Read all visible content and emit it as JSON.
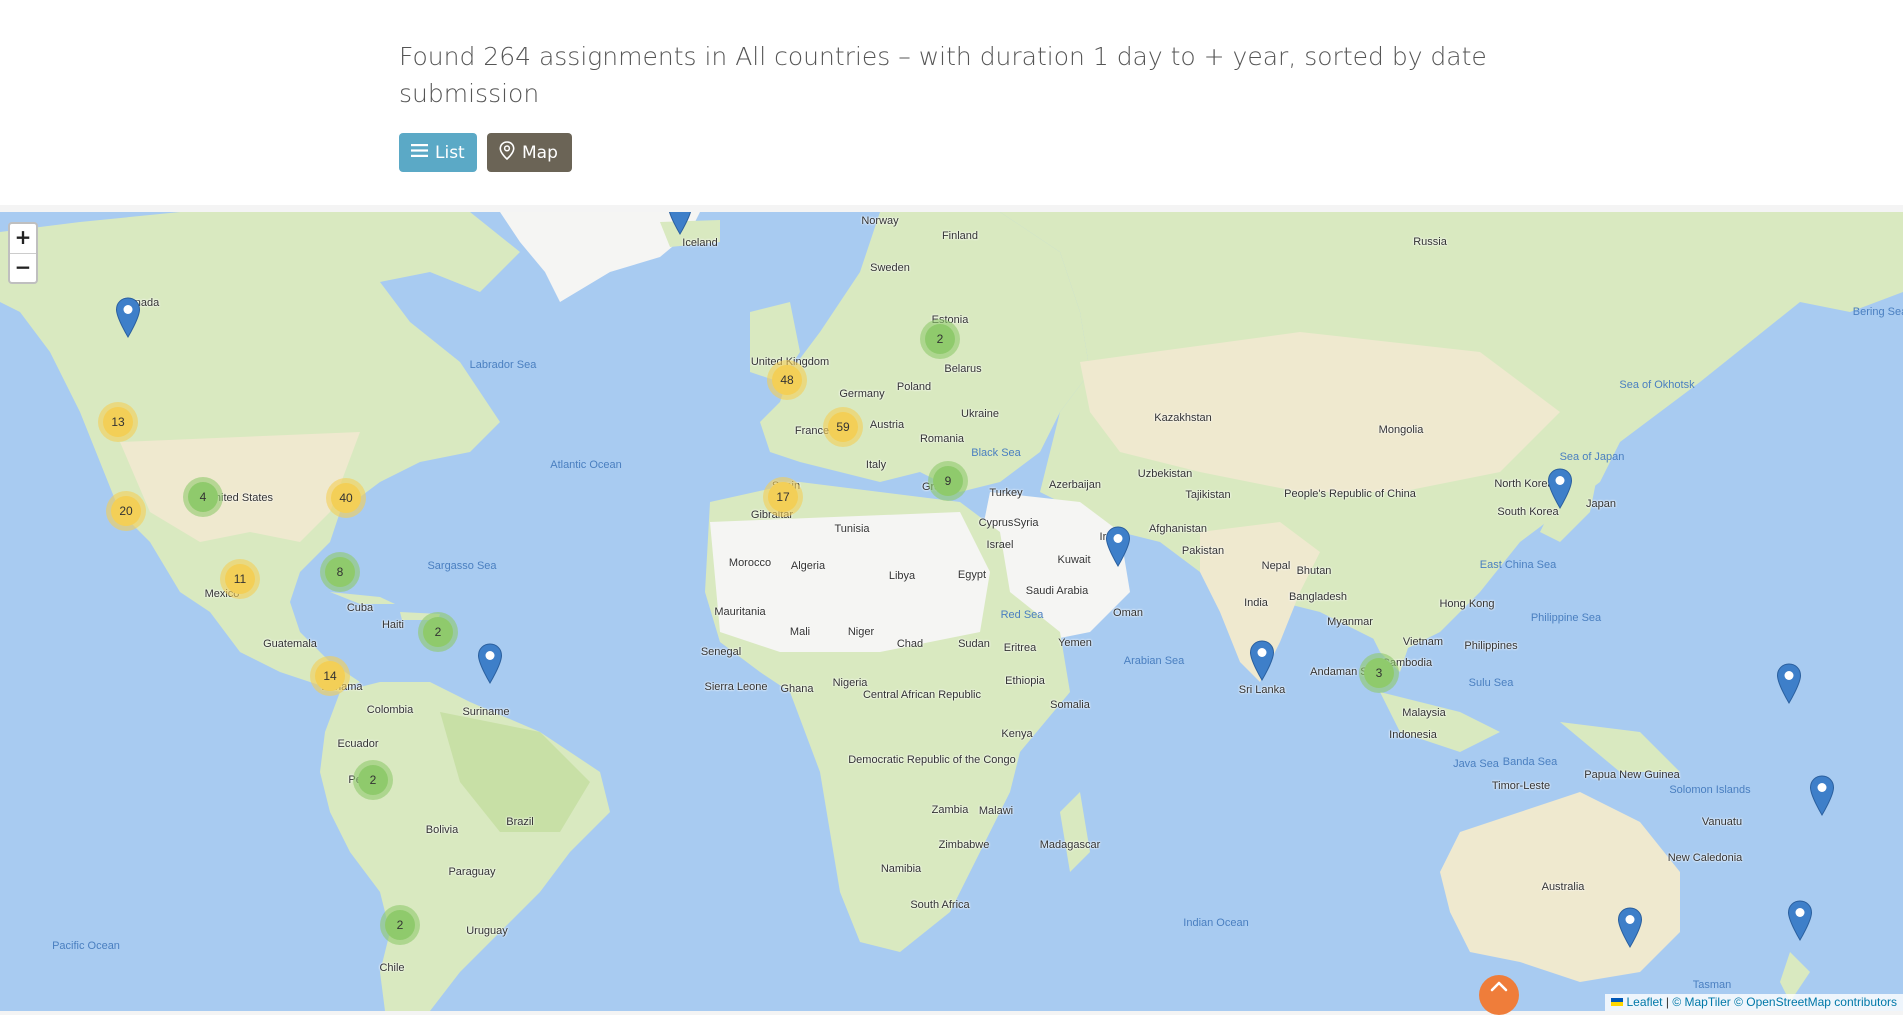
{
  "header": {
    "result_text": "Found 264 assignments in All countries – with duration 1 day to + year, sorted by date submission"
  },
  "view_toggle": {
    "list_label": "List",
    "map_label": "Map",
    "list_icon": "hamburger-icon",
    "map_icon": "map-pin-icon"
  },
  "zoom": {
    "in_label": "+",
    "out_label": "−"
  },
  "attribution": {
    "leaflet": "Leaflet",
    "separator": "|",
    "maptiler": "© MapTiler",
    "osm": "© OpenStreetMap contributors"
  },
  "colors": {
    "list_button": "#5ba9c6",
    "map_button": "#6b6456",
    "water": "#a8cbf1",
    "cluster_small": "#8fca6c",
    "cluster_large": "#f3cf57",
    "marker": "#3e7fc9",
    "scroll_top": "#ef7d3a"
  },
  "map": {
    "clusters": [
      {
        "count": "2",
        "size": "small"
      },
      {
        "count": "48",
        "size": "large"
      },
      {
        "count": "59",
        "size": "large"
      },
      {
        "count": "13",
        "size": "large"
      },
      {
        "count": "20",
        "size": "large"
      },
      {
        "count": "4",
        "size": "small"
      },
      {
        "count": "40",
        "size": "large"
      },
      {
        "count": "17",
        "size": "large"
      },
      {
        "count": "9",
        "size": "small"
      },
      {
        "count": "11",
        "size": "large"
      },
      {
        "count": "8",
        "size": "small"
      },
      {
        "count": "2",
        "size": "small"
      },
      {
        "count": "14",
        "size": "large"
      },
      {
        "count": "2",
        "size": "small"
      },
      {
        "count": "2",
        "size": "small"
      },
      {
        "count": "3",
        "size": "small"
      }
    ],
    "labels": {
      "oceans": [
        "Atlantic Ocean",
        "Pacific Ocean",
        "Indian Ocean",
        "Arabian Sea",
        "Philippine Sea",
        "Labrador Sea",
        "Sargasso Sea",
        "Sea of Okhotsk",
        "Sea of Japan",
        "East China Sea",
        "Bering Sea",
        "Java Sea",
        "Banda Sea",
        "Sulu Sea",
        "Red Sea",
        "Black Sea",
        "Solomon Islands",
        "Tasman"
      ],
      "countries": [
        "Canada",
        "United States",
        "Mexico",
        "Cuba",
        "Haiti",
        "Guatemala",
        "Panama",
        "Colombia",
        "Ecuador",
        "Suriname",
        "Peru",
        "Bolivia",
        "Brazil",
        "Paraguay",
        "Uruguay",
        "Chile",
        "Iceland",
        "Norway",
        "Sweden",
        "Finland",
        "Estonia",
        "Belarus",
        "United Kingdom",
        "Germany",
        "Poland",
        "Ukraine",
        "France",
        "Austria",
        "Romania",
        "Italy",
        "Spain",
        "Gibraltar",
        "Greece",
        "Turkey",
        "Cyprus",
        "Syria",
        "Israel",
        "Tunisia",
        "Morocco",
        "Algeria",
        "Libya",
        "Egypt",
        "Mauritania",
        "Mali",
        "Niger",
        "Chad",
        "Sudan",
        "Senegal",
        "Sierra Leone",
        "Ghana",
        "Nigeria",
        "Central African Republic",
        "Ethiopia",
        "Eritrea",
        "Yemen",
        "Somalia",
        "Kenya",
        "Democratic Republic of the Congo",
        "Zambia",
        "Malawi",
        "Zimbabwe",
        "Namibia",
        "Madagascar",
        "South Africa",
        "Saudi Arabia",
        "Kuwait",
        "Oman",
        "Iran",
        "Azerbaijan",
        "Afghanistan",
        "Pakistan",
        "Uzbekistan",
        "Tajikistan",
        "Kazakhstan",
        "Russia",
        "Mongolia",
        "People's Republic of China",
        "India",
        "Nepal",
        "Bhutan",
        "Bangladesh",
        "Sri Lanka",
        "Myanmar",
        "Andaman Sea",
        "Cambodia",
        "Vietnam",
        "Hong Kong",
        "Philippines",
        "Malaysia",
        "Indonesia",
        "Papua New Guinea",
        "Timor-Leste",
        "Australia",
        "Vanuatu",
        "New Caledonia",
        "North Korea",
        "South Korea",
        "Japan"
      ]
    }
  }
}
